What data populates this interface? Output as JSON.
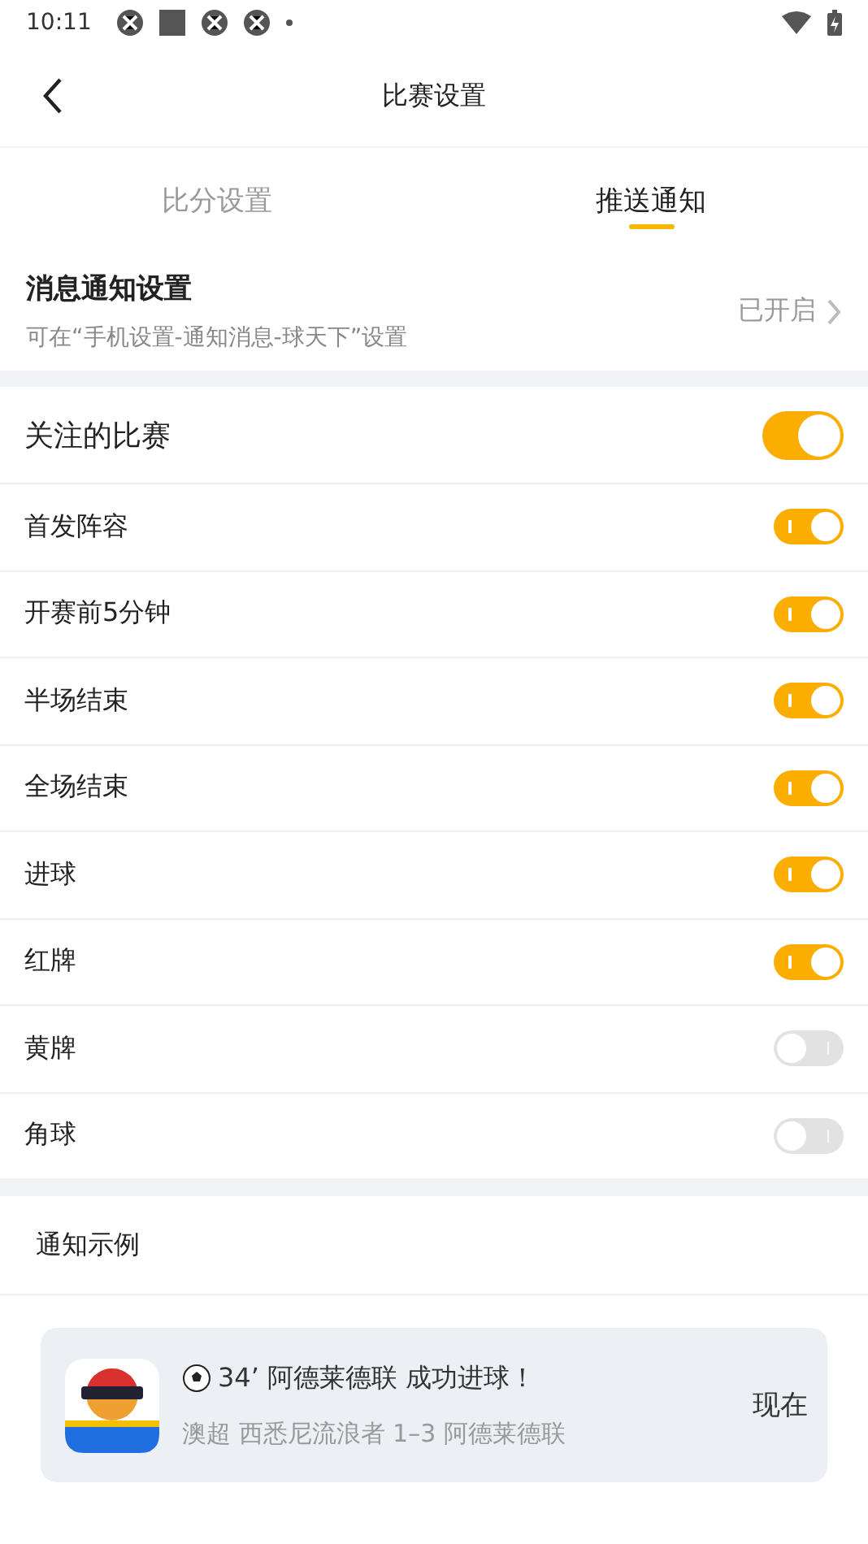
{
  "status_bar": {
    "time": "10:11"
  },
  "header": {
    "title": "比赛设置"
  },
  "tabs": [
    {
      "label": "比分设置",
      "selected": false
    },
    {
      "label": "推送通知",
      "selected": true
    }
  ],
  "notification_settings": {
    "title": "消息通知设置",
    "hint": "可在“手机设置-通知消息-球天下”设置",
    "status": "已开启"
  },
  "follow": {
    "label": "关注的比赛",
    "on": true
  },
  "events": [
    {
      "label": "首发阵容",
      "on": true
    },
    {
      "label": "开赛前5分钟",
      "on": true
    },
    {
      "label": "半场结束",
      "on": true
    },
    {
      "label": "全场结束",
      "on": true
    },
    {
      "label": "进球",
      "on": true
    },
    {
      "label": "红牌",
      "on": true
    },
    {
      "label": "黄牌",
      "on": false
    },
    {
      "label": "角球",
      "on": false
    }
  ],
  "example": {
    "title": "通知示例",
    "headline": "34’ 阿德莱德联 成功进球！",
    "detail": "澳超 西悉尼流浪者 1–3 阿德莱德联",
    "time": "现在"
  }
}
